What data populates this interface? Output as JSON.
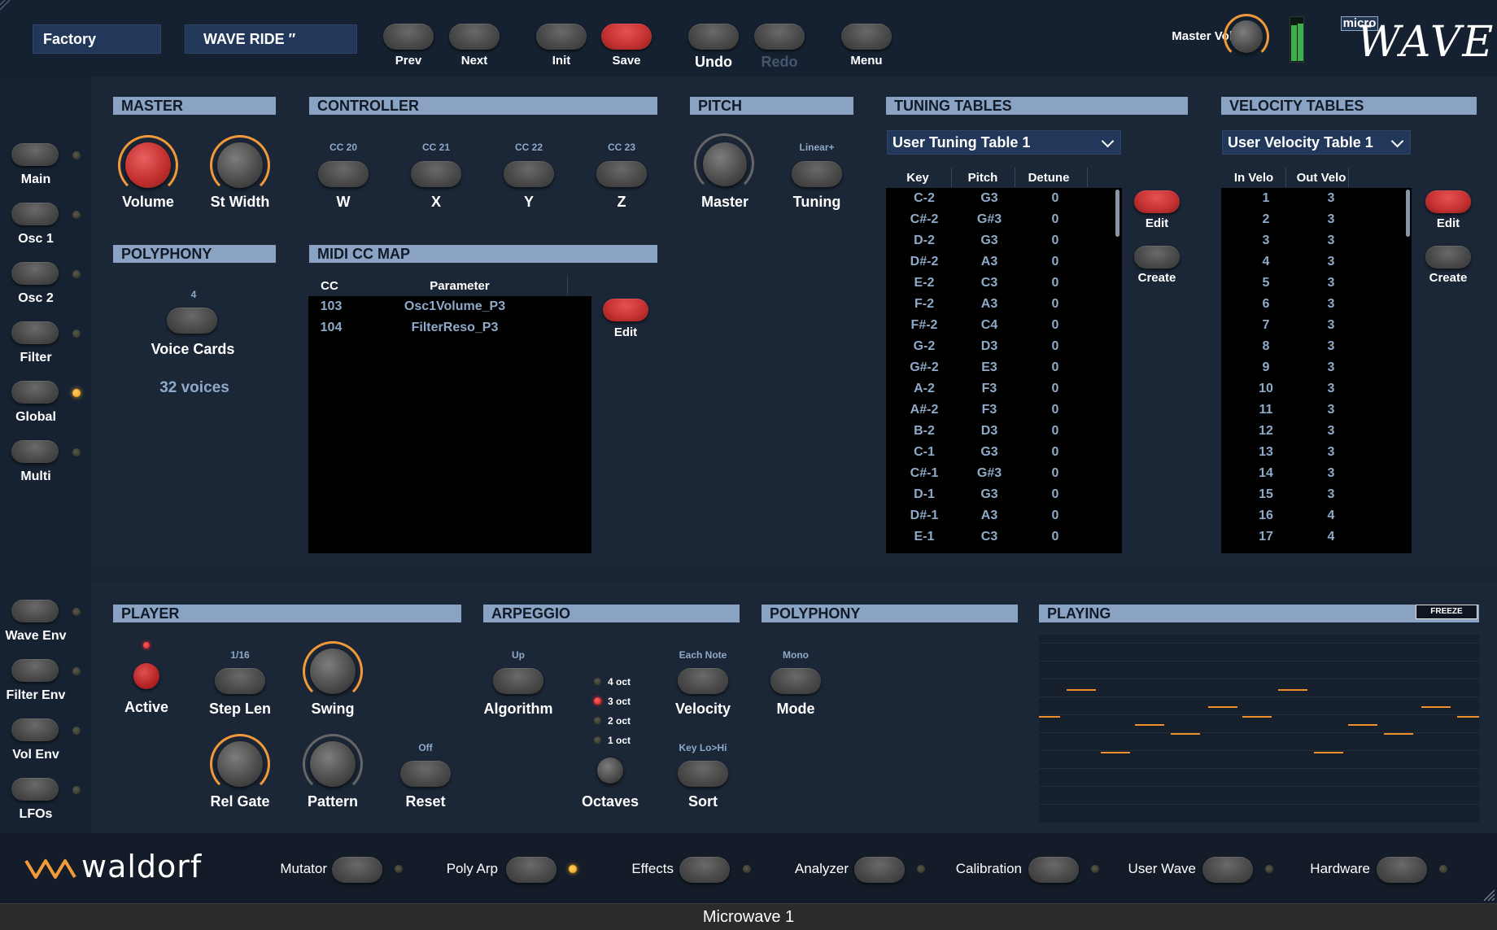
{
  "statusbar": {
    "title": "Microwave 1"
  },
  "header": {
    "bank": "Factory",
    "patch": "WAVE RIDE  ″",
    "buttons": {
      "prev": "Prev",
      "next": "Next",
      "init": "Init",
      "save": "Save",
      "undo": "Undo",
      "redo": "Redo",
      "menu": "Menu"
    },
    "master_vol_label": "Master Vol",
    "logo_small": "micro",
    "logo_big": "WAVE"
  },
  "sidebar": {
    "top_items": [
      "Main",
      "Osc 1",
      "Osc 2",
      "Filter",
      "Global",
      "Multi"
    ],
    "bottom_items": [
      "Wave Env",
      "Filter Env",
      "Vol Env",
      "LFOs"
    ],
    "active_item": "Global"
  },
  "master": {
    "title": "MASTER",
    "volume": "Volume",
    "st_width": "St Width"
  },
  "polyphony_top": {
    "title": "POLYPHONY",
    "voice_cards_value": "4",
    "voice_cards": "Voice Cards",
    "voices": "32 voices"
  },
  "controller": {
    "title": "CONTROLLER",
    "items": [
      {
        "cc": "CC 20",
        "label": "W"
      },
      {
        "cc": "CC 21",
        "label": "X"
      },
      {
        "cc": "CC 22",
        "label": "Y"
      },
      {
        "cc": "CC 23",
        "label": "Z"
      }
    ]
  },
  "midi_cc_map": {
    "title": "MIDI CC MAP",
    "col_cc": "CC",
    "col_param": "Parameter",
    "rows": [
      {
        "cc": "103",
        "param": "Osc1Volume_P3"
      },
      {
        "cc": "104",
        "param": "FilterReso_P3"
      }
    ],
    "edit": "Edit"
  },
  "pitch": {
    "title": "PITCH",
    "master": "Master",
    "tuning_mode": "Linear+",
    "tuning": "Tuning"
  },
  "tuning_tables": {
    "title": "TUNING TABLES",
    "selected": "User Tuning Table 1",
    "col_key": "Key",
    "col_pitch": "Pitch",
    "col_detune": "Detune",
    "rows": [
      [
        "C-2",
        "G3",
        "0"
      ],
      [
        "C#-2",
        "G#3",
        "0"
      ],
      [
        "D-2",
        "G3",
        "0"
      ],
      [
        "D#-2",
        "A3",
        "0"
      ],
      [
        "E-2",
        "C3",
        "0"
      ],
      [
        "F-2",
        "A3",
        "0"
      ],
      [
        "F#-2",
        "C4",
        "0"
      ],
      [
        "G-2",
        "D3",
        "0"
      ],
      [
        "G#-2",
        "E3",
        "0"
      ],
      [
        "A-2",
        "F3",
        "0"
      ],
      [
        "A#-2",
        "F3",
        "0"
      ],
      [
        "B-2",
        "D3",
        "0"
      ],
      [
        "C-1",
        "G3",
        "0"
      ],
      [
        "C#-1",
        "G#3",
        "0"
      ],
      [
        "D-1",
        "G3",
        "0"
      ],
      [
        "D#-1",
        "A3",
        "0"
      ],
      [
        "E-1",
        "C3",
        "0"
      ]
    ],
    "edit": "Edit",
    "create": "Create"
  },
  "velocity_tables": {
    "title": "VELOCITY TABLES",
    "selected": "User Velocity Table 1",
    "col_in": "In Velo",
    "col_out": "Out Velo",
    "rows": [
      [
        "1",
        "3"
      ],
      [
        "2",
        "3"
      ],
      [
        "3",
        "3"
      ],
      [
        "4",
        "3"
      ],
      [
        "5",
        "3"
      ],
      [
        "6",
        "3"
      ],
      [
        "7",
        "3"
      ],
      [
        "8",
        "3"
      ],
      [
        "9",
        "3"
      ],
      [
        "10",
        "3"
      ],
      [
        "11",
        "3"
      ],
      [
        "12",
        "3"
      ],
      [
        "13",
        "3"
      ],
      [
        "14",
        "3"
      ],
      [
        "15",
        "3"
      ],
      [
        "16",
        "4"
      ],
      [
        "17",
        "4"
      ]
    ],
    "edit": "Edit",
    "create": "Create"
  },
  "player": {
    "title": "PLAYER",
    "active": "Active",
    "step_len_value": "1/16",
    "step_len": "Step Len",
    "swing": "Swing",
    "rel_gate": "Rel Gate",
    "pattern": "Pattern",
    "reset_value": "Off",
    "reset": "Reset"
  },
  "arpeggio": {
    "title": "ARPEGGIO",
    "algorithm_value": "Up",
    "algorithm": "Algorithm",
    "octave_options": [
      "4 oct",
      "3 oct",
      "2 oct",
      "1 oct"
    ],
    "octave_selected": "3 oct",
    "octaves": "Octaves",
    "velocity_value": "Each Note",
    "velocity": "Velocity",
    "sort_value": "Key Lo>Hi",
    "sort": "Sort"
  },
  "polyphony_bottom": {
    "title": "POLYPHONY",
    "mode_value": "Mono",
    "mode": "Mode"
  },
  "playing": {
    "title": "PLAYING",
    "freeze": "FREEZE"
  },
  "footer": {
    "brand": "waldorf",
    "items": [
      "Mutator",
      "Poly Arp",
      "Effects",
      "Analyzer",
      "Calibration",
      "User Wave",
      "Hardware"
    ],
    "active_item": "Poly Arp"
  },
  "colors": {
    "accent_orange": "#f29a3a",
    "section_header": "#8aa3c2",
    "value_blue": "#8eaac8",
    "record_red": "#c73232"
  }
}
